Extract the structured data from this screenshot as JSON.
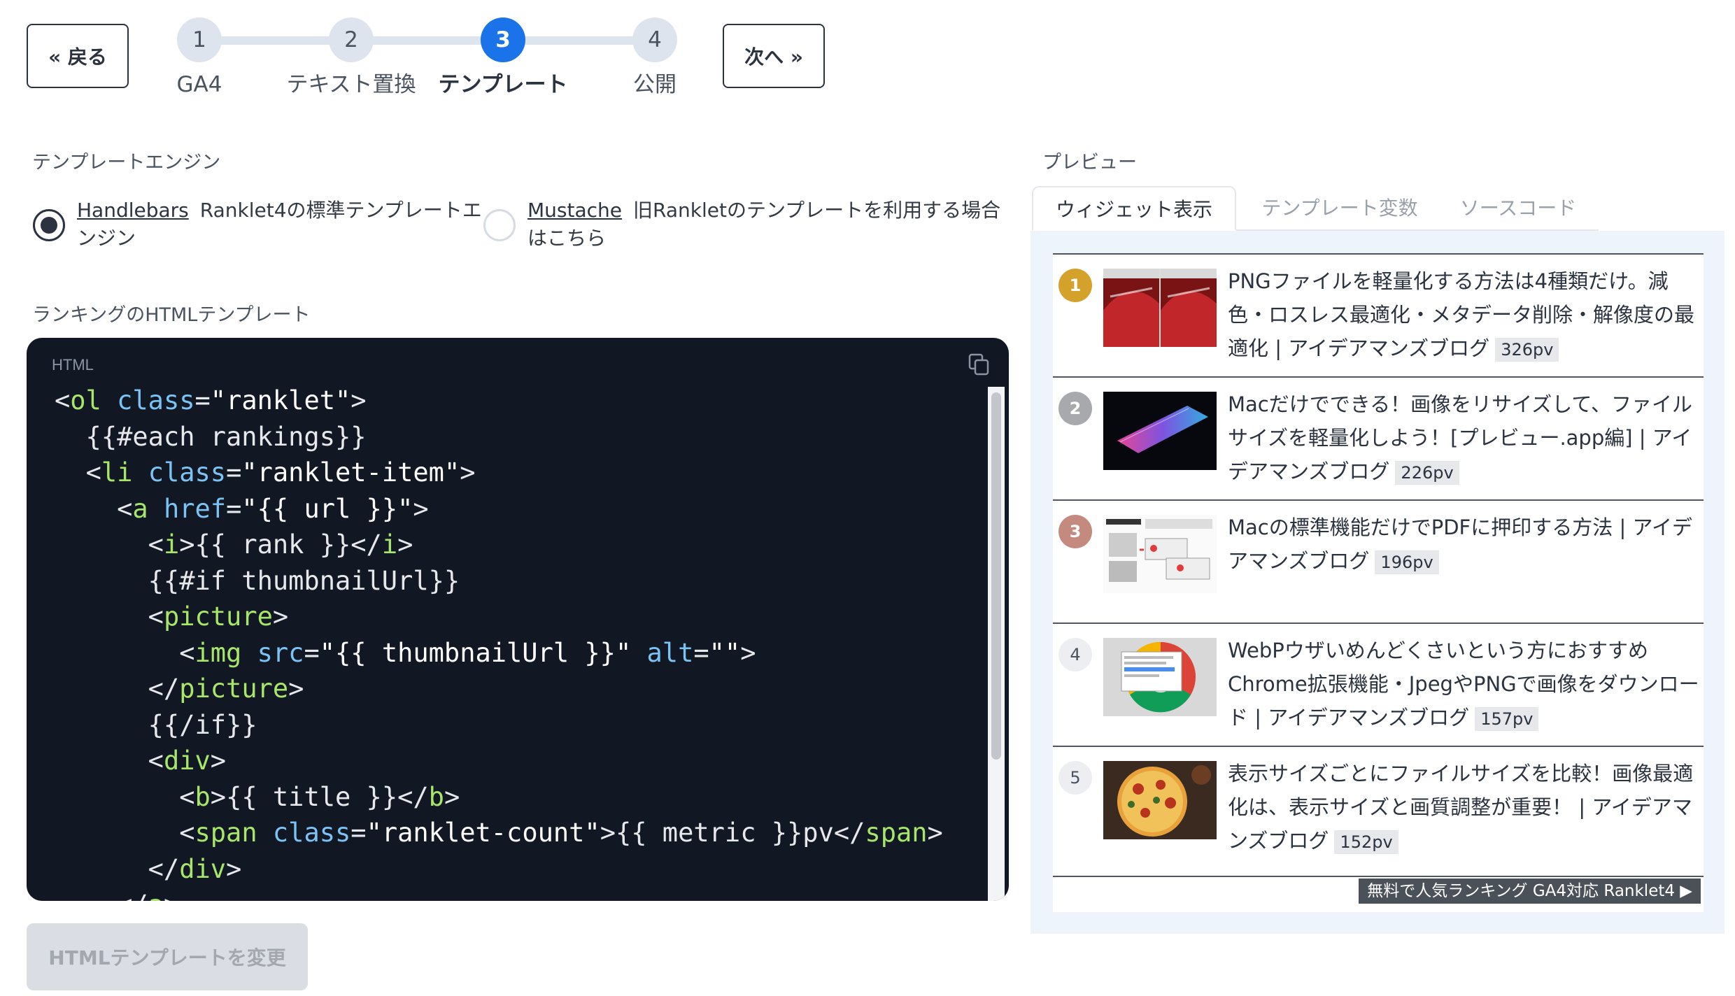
{
  "wizard": {
    "back_label": "« 戻る",
    "next_label": "次へ »",
    "steps": [
      {
        "number": "1",
        "label": "GA4"
      },
      {
        "number": "2",
        "label": "テキスト置換"
      },
      {
        "number": "3",
        "label": "テンプレート"
      },
      {
        "number": "4",
        "label": "公開"
      }
    ],
    "active_step": "3"
  },
  "engine": {
    "heading": "テンプレートエンジン",
    "options": [
      {
        "name": "Handlebars",
        "description_line1": "Ranklet4の標準テンプレートエ",
        "description_line2": "ンジン",
        "selected": true
      },
      {
        "name": "Mustache",
        "description_line1": "旧Rankletのテンプレートを利用する場合",
        "description_line2": "はこちら",
        "selected": false
      }
    ]
  },
  "template": {
    "heading": "ランキングのHTMLテンプレート",
    "language": "HTML",
    "lines": [
      "<ol class=\"ranklet\">",
      "  {{#each rankings}}",
      "  <li class=\"ranklet-item\">",
      "    <a href=\"{{ url }}\">",
      "      <i>{{ rank }}</i>",
      "      {{#if thumbnailUrl}}",
      "      <picture>",
      "        <img src=\"{{ thumbnailUrl }}\" alt=\"\">",
      "      </picture>",
      "      {{/if}}",
      "      <div>",
      "        <b>{{ title }}</b>",
      "        <span class=\"ranklet-count\">{{ metric }}pv</span>",
      "      </div>",
      "    </a>"
    ],
    "apply_label": "HTMLテンプレートを変更"
  },
  "preview": {
    "heading": "プレビュー",
    "tabs": [
      "ウィジェット表示",
      "テンプレート変数",
      "ソースコード"
    ],
    "active_tab": "ウィジェット表示",
    "items": [
      {
        "rank": "1",
        "title": "PNGファイルを軽量化する方法は4種類だけ。減色・ロスレス最適化・メタデータ削除・解像度の最適化 | アイデアマンズブログ",
        "pv": "326pv",
        "badge_color": "#d4a22a",
        "thumbnail": "red-car-photo"
      },
      {
        "rank": "2",
        "title": "Macだけでできる！画像をリサイズして、ファイルサイズを軽量化しよう！[プレビュー.app編] | アイデアマンズブログ",
        "pv": "226pv",
        "badge_color": "#a7a9ad",
        "thumbnail": "keyboard-photo"
      },
      {
        "rank": "3",
        "title": "Macの標準機能だけでPDFに押印する方法 | アイデアマンズブログ",
        "pv": "196pv",
        "badge_color": "#c48a80",
        "thumbnail": "pdf-screenshot"
      },
      {
        "rank": "4",
        "title": "WebPウザいめんどくさいという方におすすめChrome拡張機能・JpegやPNGで画像をダウンロード | アイデアマンズブログ",
        "pv": "157pv",
        "badge_color": "",
        "thumbnail": "chrome-logo"
      },
      {
        "rank": "5",
        "title": "表示サイズごとにファイルサイズを比較！画像最適化は、表示サイズと画質調整が重要！ | アイデアマンズブログ",
        "pv": "152pv",
        "badge_color": "",
        "thumbnail": "pizza-photo"
      }
    ],
    "promo": "無料で人気ランキング GA4対応 Ranklet4 ▶"
  }
}
